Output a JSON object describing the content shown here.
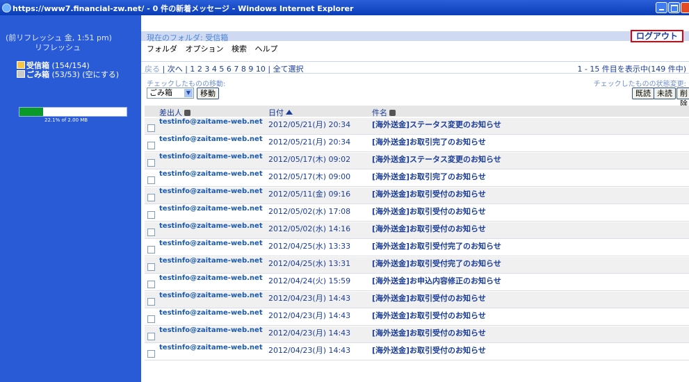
{
  "window": {
    "title": "https://www7.financial-zw.net/ - 0 件の新着メッセージ - Windows Internet Explorer"
  },
  "sidebar": {
    "refresh_info": "(前リフレッシュ 金, 1:51 pm)",
    "refresh_link": "リフレッシュ",
    "inbox_label": "受信箱",
    "inbox_count": "(154/154)",
    "trash_label": "ごみ箱",
    "trash_count": "(53/53)",
    "trash_empty": "(空にする)",
    "quota_text": "22.1% of 2.00 MB",
    "quota_fraction": 0.221
  },
  "header": {
    "current_folder": "現在のフォルダ: 受信箱",
    "logout_label": "ログアウト",
    "menu": [
      "フォルダ",
      "オプション",
      "検索",
      "ヘルプ"
    ]
  },
  "pager": {
    "prev": "戻る",
    "next": "次へ",
    "pages": "1 2 3 4 5 6 7 8 9 10",
    "select_all": "全て選択",
    "count": "1 - 15 件目を表示中(149 件中)"
  },
  "actions": {
    "move_label": "チェックしたものの移動:",
    "status_label": "チェックしたものの状態変更:",
    "move_select_value": "ごみ箱",
    "move_button": "移動",
    "read_button": "既読",
    "unread_button": "未読",
    "delete_button": "削除"
  },
  "list": {
    "columns": {
      "sender": "差出人",
      "date": "日付",
      "subject": "件名"
    },
    "rows": [
      {
        "sender": "testinfo@zaitame-web.net",
        "date": "2012/05/21(月) 20:34",
        "subject": "[海外送金]ステータス変更のお知らせ"
      },
      {
        "sender": "testinfo@zaitame-web.net",
        "date": "2012/05/21(月) 20:34",
        "subject": "[海外送金]お取引完了のお知らせ"
      },
      {
        "sender": "testinfo@zaitame-web.net",
        "date": "2012/05/17(木) 09:02",
        "subject": "[海外送金]ステータス変更のお知らせ"
      },
      {
        "sender": "testinfo@zaitame-web.net",
        "date": "2012/05/17(木) 09:00",
        "subject": "[海外送金]お取引完了のお知らせ"
      },
      {
        "sender": "testinfo@zaitame-web.net",
        "date": "2012/05/11(金) 09:16",
        "subject": "[海外送金]お取引受付のお知らせ"
      },
      {
        "sender": "testinfo@zaitame-web.net",
        "date": "2012/05/02(水) 17:08",
        "subject": "[海外送金]お取引受付のお知らせ"
      },
      {
        "sender": "testinfo@zaitame-web.net",
        "date": "2012/05/02(水) 14:16",
        "subject": "[海外送金]お取引受付のお知らせ"
      },
      {
        "sender": "testinfo@zaitame-web.net",
        "date": "2012/04/25(水) 13:33",
        "subject": "[海外送金]お取引受付完了のお知らせ"
      },
      {
        "sender": "testinfo@zaitame-web.net",
        "date": "2012/04/25(水) 13:31",
        "subject": "[海外送金]お取引受付完了のお知らせ"
      },
      {
        "sender": "testinfo@zaitame-web.net",
        "date": "2012/04/24(火) 15:59",
        "subject": "[海外送金]お申込内容修正のお知らせ"
      },
      {
        "sender": "testinfo@zaitame-web.net",
        "date": "2012/04/23(月) 14:43",
        "subject": "[海外送金]お取引受付のお知らせ"
      },
      {
        "sender": "testinfo@zaitame-web.net",
        "date": "2012/04/23(月) 14:43",
        "subject": "[海外送金]お取引受付のお知らせ"
      },
      {
        "sender": "testinfo@zaitame-web.net",
        "date": "2012/04/23(月) 14:43",
        "subject": "[海外送金]お取引受付のお知らせ"
      },
      {
        "sender": "testinfo@zaitame-web.net",
        "date": "2012/04/23(月) 14:43",
        "subject": "[海外送金]お取引受付のお知らせ"
      }
    ]
  }
}
